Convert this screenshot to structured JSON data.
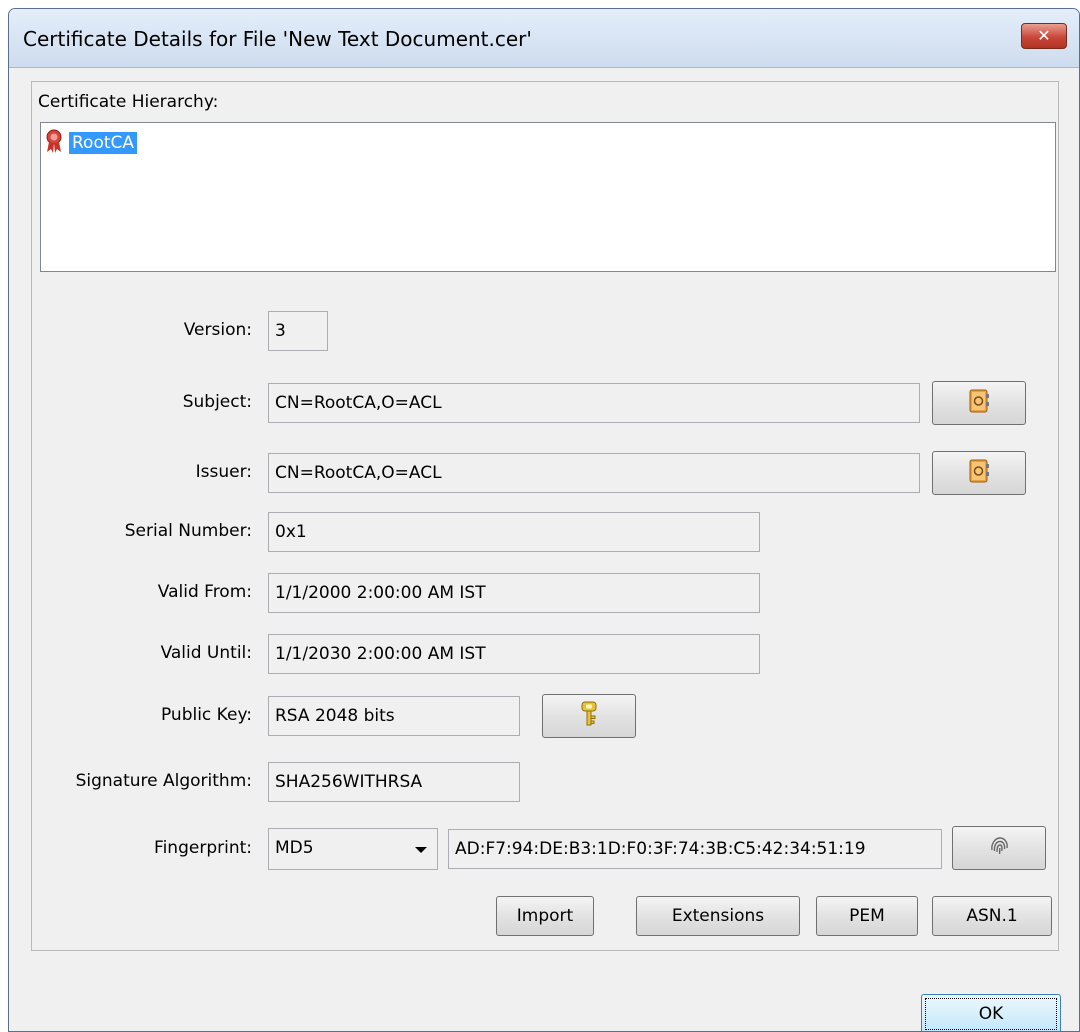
{
  "window": {
    "title": "Certificate Details for File 'New Text Document.cer'",
    "close_label": "✕"
  },
  "hierarchy": {
    "label": "Certificate Hierarchy:",
    "items": [
      {
        "label": "RootCA",
        "selected": true
      }
    ]
  },
  "fields": {
    "version": {
      "label": "Version:",
      "value": "3"
    },
    "subject": {
      "label": "Subject:",
      "value": "CN=RootCA,O=ACL"
    },
    "issuer": {
      "label": "Issuer:",
      "value": "CN=RootCA,O=ACL"
    },
    "serial": {
      "label": "Serial Number:",
      "value": "0x1"
    },
    "valid_from": {
      "label": "Valid From:",
      "value": "1/1/2000 2:00:00 AM IST"
    },
    "valid_until": {
      "label": "Valid Until:",
      "value": "1/1/2030 2:00:00 AM IST"
    },
    "public_key": {
      "label": "Public Key:",
      "value": "RSA 2048 bits"
    },
    "signature_algorithm": {
      "label": "Signature Algorithm:",
      "value": "SHA256WITHRSA"
    },
    "fingerprint": {
      "label": "Fingerprint:",
      "algorithm": "MD5",
      "value": "AD:F7:94:DE:B3:1D:F0:3F:74:3B:C5:42:34:51:19"
    }
  },
  "buttons": {
    "import": "Import",
    "extensions": "Extensions",
    "pem": "PEM",
    "asn1": "ASN.1",
    "ok": "OK"
  },
  "icons": {
    "subject_details": "address-book-icon",
    "issuer_details": "address-book-icon",
    "public_key_details": "key-icon",
    "fingerprint_details": "fingerprint-icon",
    "certificate": "certificate-ribbon-icon"
  },
  "colors": {
    "selection": "#3399ff",
    "close_button": "#c9473a"
  }
}
